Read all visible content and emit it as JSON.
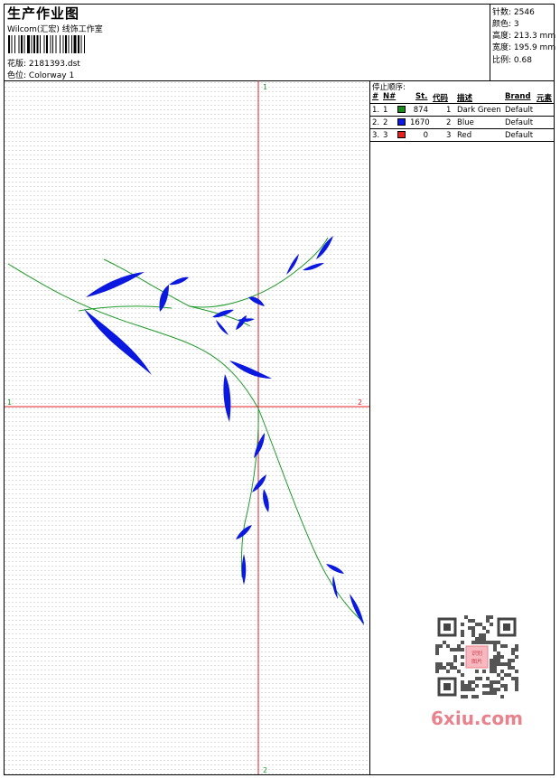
{
  "header": {
    "title": "生产作业图",
    "company": "Wilcom(汇宏) 线饰工作室",
    "design_label": "花版:",
    "design_value": "2181393.dst",
    "color_label": "色位:",
    "color_value": "Colorway 1"
  },
  "stats": {
    "stitches_label": "针数:",
    "stitches_value": "2546",
    "colors_label": "颜色:",
    "colors_value": "3",
    "height_label": "高度:",
    "height_value": "213.3 mm",
    "width_label": "宽度:",
    "width_value": "195.9 mm",
    "scale_label": "比例:",
    "scale_value": "0.68"
  },
  "canvas": {
    "axis_labels": {
      "top": "1",
      "bottom": "2",
      "left": "1",
      "right": "2"
    },
    "colors": {
      "axis": "#e8202a",
      "stem": "#1f9a2a",
      "leaf": "#0a18e0",
      "grid": "#c8c8c8"
    }
  },
  "panel": {
    "title": "停止顺序:",
    "columns": [
      "#",
      "N#",
      "St.",
      "代码",
      "描述",
      "Brand",
      "元素"
    ],
    "rows": [
      {
        "num": "1.",
        "n": "1",
        "st": "874",
        "code": "1",
        "desc": "Dark Green",
        "brand": "Default",
        "color": "#1a8a1a"
      },
      {
        "num": "2.",
        "n": "2",
        "st": "1670",
        "code": "2",
        "desc": "Blue",
        "brand": "Default",
        "color": "#0a18e0"
      },
      {
        "num": "3.",
        "n": "3",
        "st": "0",
        "code": "3",
        "desc": "Red",
        "brand": "Default",
        "color": "#e82020"
      }
    ]
  },
  "watermark": {
    "text": "6xiu.com",
    "qr_label": "识别图片"
  }
}
